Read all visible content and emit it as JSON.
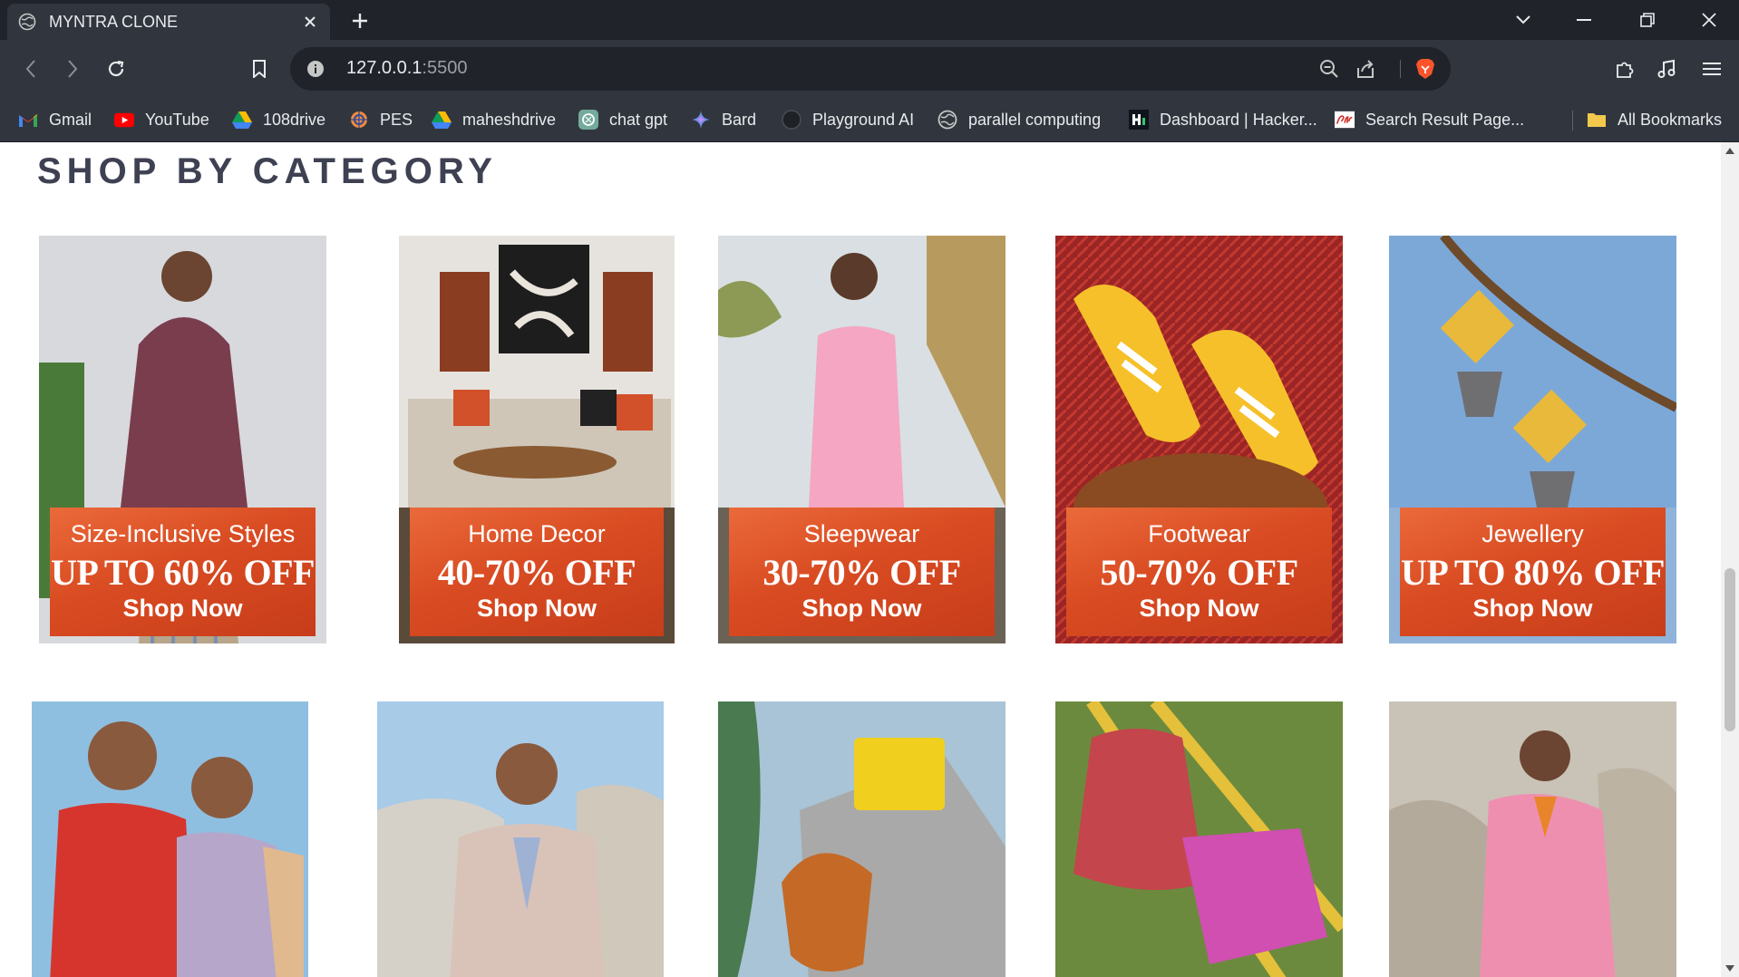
{
  "browser": {
    "tab_title": "MYNTRA CLONE",
    "url_host": "127.0.0.1",
    "url_port": ":5500",
    "bookmarks": [
      {
        "label": "Gmail",
        "icon": "gmail-icon"
      },
      {
        "label": "YouTube",
        "icon": "youtube-icon"
      },
      {
        "label": "108drive",
        "icon": "google-drive-icon"
      },
      {
        "label": "PES",
        "icon": "pes-icon"
      },
      {
        "label": "maheshdrive",
        "icon": "google-drive-icon"
      },
      {
        "label": "chat gpt",
        "icon": "chatgpt-icon"
      },
      {
        "label": "Bard",
        "icon": "bard-icon"
      },
      {
        "label": "Playground AI",
        "icon": "playground-ai-icon"
      },
      {
        "label": "parallel computing",
        "icon": "globe-icon"
      },
      {
        "label": "Dashboard | Hacker...",
        "icon": "hackerrank-icon"
      },
      {
        "label": "Search Result Page...",
        "icon": "search-result-icon"
      }
    ],
    "all_bookmarks_label": "All Bookmarks"
  },
  "page": {
    "section_title": "SHOP BY CATEGORY",
    "categories": [
      {
        "title": "Size-Inclusive Styles",
        "offer": "UP TO 60% OFF",
        "cta": "Shop Now"
      },
      {
        "title": "Home Decor",
        "offer": "40-70% OFF",
        "cta": "Shop Now"
      },
      {
        "title": "Sleepwear",
        "offer": "30-70% OFF",
        "cta": "Shop Now"
      },
      {
        "title": "Footwear",
        "offer": "50-70% OFF",
        "cta": "Shop Now"
      },
      {
        "title": "Jewellery",
        "offer": "UP TO 80% OFF",
        "cta": "Shop Now"
      }
    ],
    "second_row": [
      "ethnic-wear",
      "blazers",
      "handbags",
      "kids-wear",
      "western-wear"
    ]
  },
  "colors": {
    "chrome_dark": "#20242a",
    "chrome": "#31363e",
    "banner_orange": "#d94b22",
    "title_text": "#3e4152"
  }
}
